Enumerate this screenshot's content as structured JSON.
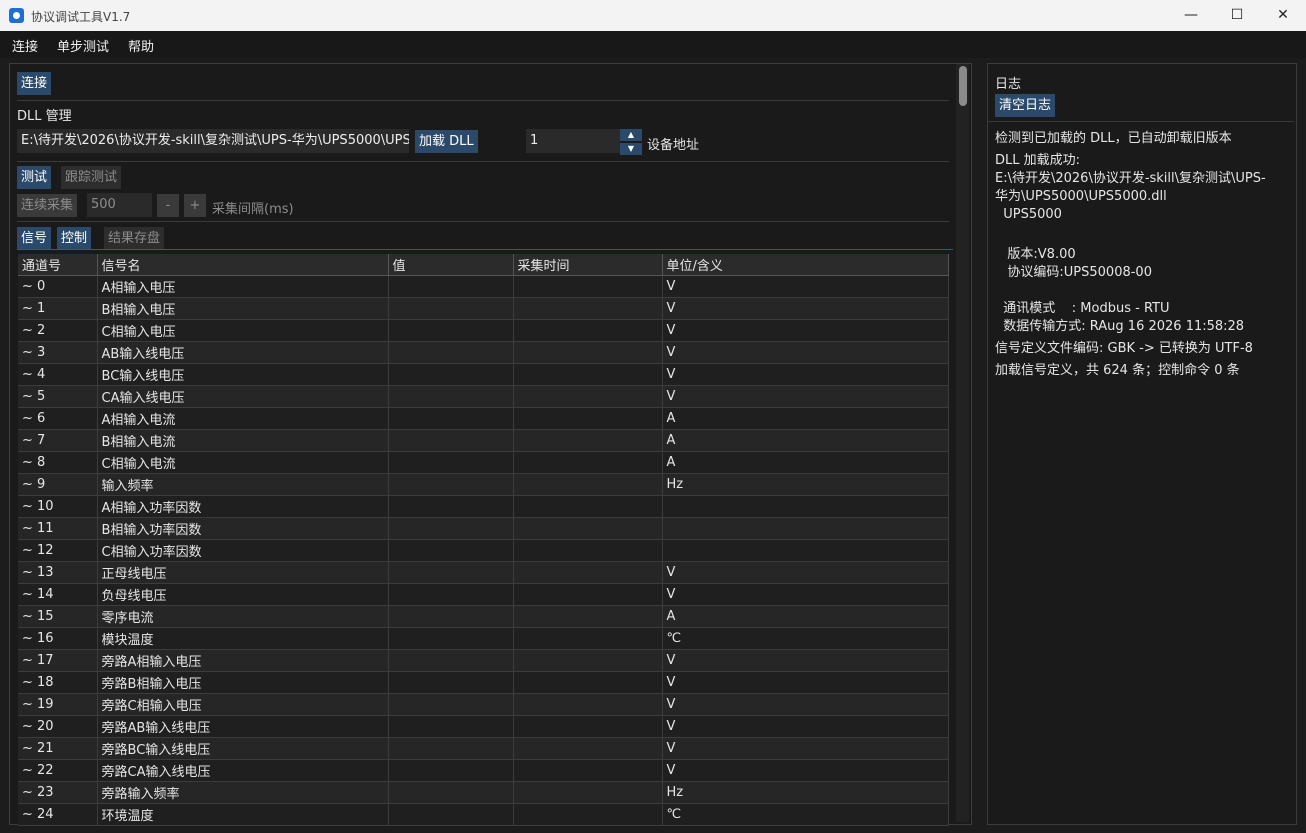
{
  "window": {
    "title": "协议调试工具V1.7",
    "minimize": "—",
    "maximize": "☐",
    "close": "✕"
  },
  "menu": [
    "连接",
    "单步测试",
    "帮助"
  ],
  "left": {
    "connect_button": "连接",
    "dll_section_label": "DLL 管理",
    "dll_path": "E:\\待开发\\2026\\协议开发-skill\\复杂测试\\UPS-华为\\UPS5000\\UPS5000.dll",
    "load_dll_button": "加载 DLL",
    "device_address_value": "1",
    "device_address_label": "设备地址",
    "test_tabs": [
      "测试",
      "跟踪测试"
    ],
    "continuous_button": "连续采集",
    "interval_value": "500",
    "minus_button": "-",
    "plus_button": "+",
    "interval_label": "采集间隔(ms)",
    "data_tabs": [
      "信号",
      "控制",
      "结果存盘"
    ]
  },
  "table": {
    "columns": [
      "通道号",
      "信号名",
      "值",
      "采集时间",
      "单位/含义"
    ],
    "rows": [
      [
        "~ 0",
        "A相输入电压",
        "",
        "",
        "V"
      ],
      [
        "~ 1",
        "B相输入电压",
        "",
        "",
        "V"
      ],
      [
        "~ 2",
        "C相输入电压",
        "",
        "",
        "V"
      ],
      [
        "~ 3",
        "AB输入线电压",
        "",
        "",
        "V"
      ],
      [
        "~ 4",
        "BC输入线电压",
        "",
        "",
        "V"
      ],
      [
        "~ 5",
        "CA输入线电压",
        "",
        "",
        "V"
      ],
      [
        "~ 6",
        "A相输入电流",
        "",
        "",
        "A"
      ],
      [
        "~ 7",
        "B相输入电流",
        "",
        "",
        "A"
      ],
      [
        "~ 8",
        "C相输入电流",
        "",
        "",
        "A"
      ],
      [
        "~ 9",
        "输入频率",
        "",
        "",
        "Hz"
      ],
      [
        "~ 10",
        "A相输入功率因数",
        "",
        "",
        ""
      ],
      [
        "~ 11",
        "B相输入功率因数",
        "",
        "",
        ""
      ],
      [
        "~ 12",
        "C相输入功率因数",
        "",
        "",
        ""
      ],
      [
        "~ 13",
        "正母线电压",
        "",
        "",
        "V"
      ],
      [
        "~ 14",
        "负母线电压",
        "",
        "",
        "V"
      ],
      [
        "~ 15",
        "零序电流",
        "",
        "",
        "A"
      ],
      [
        "~ 16",
        "模块温度",
        "",
        "",
        "℃"
      ],
      [
        "~ 17",
        "旁路A相输入电压",
        "",
        "",
        "V"
      ],
      [
        "~ 18",
        "旁路B相输入电压",
        "",
        "",
        "V"
      ],
      [
        "~ 19",
        "旁路C相输入电压",
        "",
        "",
        "V"
      ],
      [
        "~ 20",
        "旁路AB输入线电压",
        "",
        "",
        "V"
      ],
      [
        "~ 21",
        "旁路BC输入线电压",
        "",
        "",
        "V"
      ],
      [
        "~ 22",
        "旁路CA输入线电压",
        "",
        "",
        "V"
      ],
      [
        "~ 23",
        "旁路输入频率",
        "",
        "",
        "Hz"
      ],
      [
        "~ 24",
        "环境温度",
        "",
        "",
        "℃"
      ]
    ]
  },
  "log": {
    "title": "日志",
    "clear_button": "清空日志",
    "lines": [
      "检测到已加载的 DLL，已自动卸载旧版本",
      "DLL 加载成功:",
      "E:\\待开发\\2026\\协议开发-skill\\复杂测试\\UPS-",
      "华为\\UPS5000\\UPS5000.dll",
      "  UPS5000",
      "",
      "   版本:V8.00",
      "   协议编码:UPS50008-00",
      "",
      "  通讯模式    : Modbus - RTU",
      "  数据传输方式: RAug 16 2026 11:58:28",
      "信号定义文件编码: GBK -> 已转换为 UTF-8",
      "加载信号定义，共 624 条；控制命令 0 条"
    ]
  }
}
